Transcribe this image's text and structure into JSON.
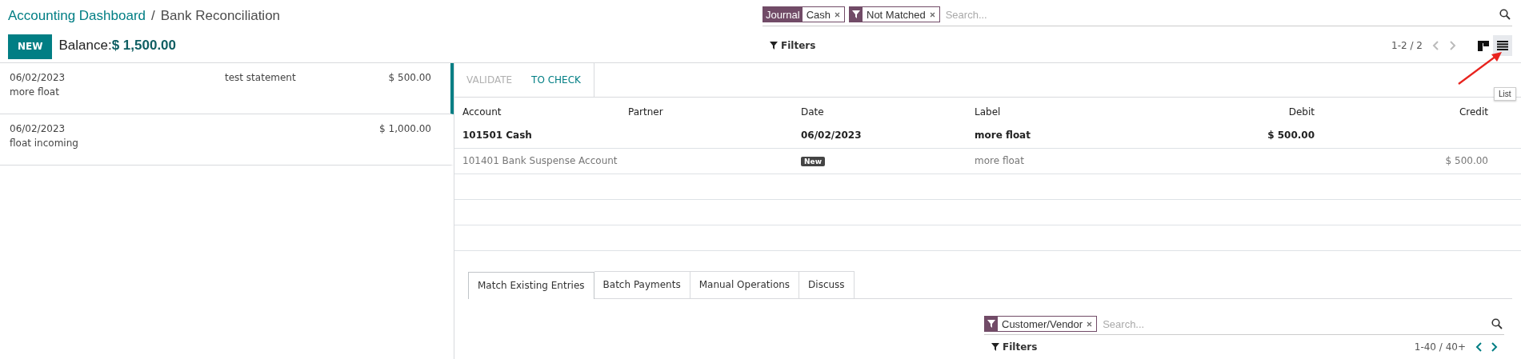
{
  "breadcrumb": [
    {
      "label": "Accounting Dashboard",
      "kind": "link"
    },
    {
      "label": "Bank Reconciliation",
      "kind": "current"
    }
  ],
  "breadcrumb_separator": "/",
  "new_button": "NEW",
  "balance": {
    "label": "Balance:",
    "value": "$ 1,500.00"
  },
  "search": {
    "facets": [
      {
        "kind": "field",
        "field": "Journal",
        "value": "Cash"
      },
      {
        "kind": "filter",
        "value": "Not Matched"
      }
    ],
    "placeholder": "Search..."
  },
  "filters_button": "Filters",
  "pager": {
    "text": "1-2 / 2",
    "nav_disabled": true
  },
  "view_switcher": [
    {
      "kind": "kanban",
      "selected": false
    },
    {
      "kind": "list",
      "selected": true
    }
  ],
  "tooltip": "List",
  "statements": [
    {
      "date": "06/02/2023",
      "reference": "test statement",
      "amount": "$ 500.00",
      "label": "more float",
      "selected": true
    },
    {
      "date": "06/02/2023",
      "amount": "$ 1,000.00",
      "label": "float incoming",
      "selected": false
    }
  ],
  "actions": [
    {
      "label": "VALIDATE",
      "disabled": true
    },
    {
      "label": "TO CHECK",
      "disabled": false
    }
  ],
  "lines_table": {
    "columns": [
      "Account",
      "Partner",
      "Date",
      "Label",
      "Debit",
      "Credit"
    ],
    "rows": [
      {
        "kind": "entry",
        "account": "101501 Cash",
        "date": "06/02/2023",
        "label": "more float",
        "debit": "$ 500.00"
      },
      {
        "kind": "suspense",
        "account": "101401 Bank Suspense Account",
        "badge": "New",
        "label": "more float",
        "credit": "$ 500.00"
      }
    ]
  },
  "tabs": [
    {
      "label": "Match Existing Entries",
      "selected": true
    },
    {
      "label": "Batch Payments",
      "selected": false
    },
    {
      "label": "Manual Operations",
      "selected": false
    },
    {
      "label": "Discuss",
      "selected": false
    }
  ],
  "match_search": {
    "facets": [
      {
        "kind": "filter",
        "value": "Customer/Vendor"
      }
    ],
    "placeholder": "Search..."
  },
  "match_filters_button": "Filters",
  "match_pager": {
    "text": "1-40 / 40+",
    "nav_disabled": false
  }
}
